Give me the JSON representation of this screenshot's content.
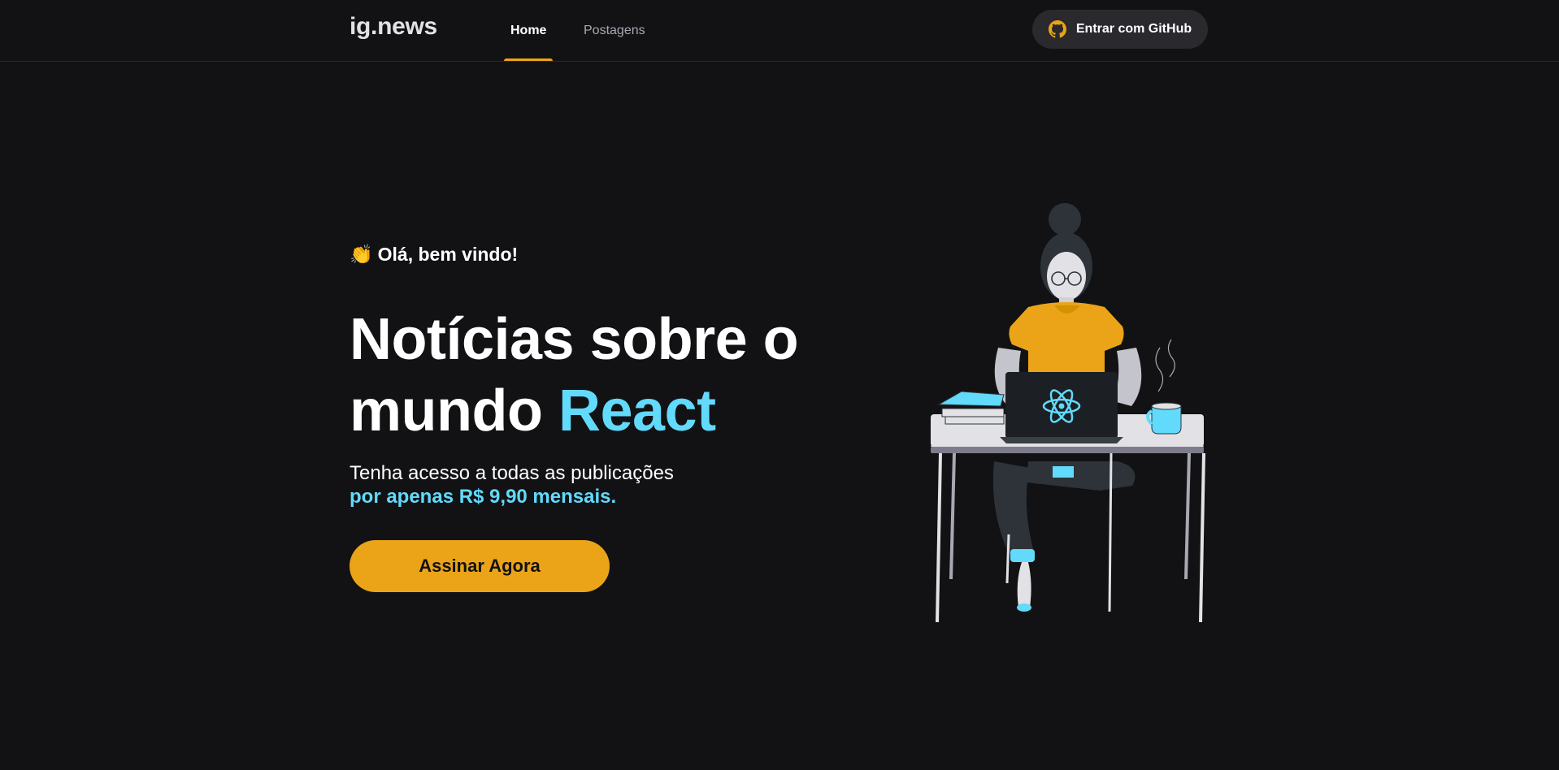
{
  "header": {
    "logo": "ig.news",
    "nav": [
      {
        "label": "Home",
        "active": true
      },
      {
        "label": "Postagens",
        "active": false
      }
    ],
    "github_button": "Entrar com GitHub"
  },
  "hero": {
    "welcome_emoji": "👏",
    "welcome": "Olá, bem vindo!",
    "headline_part1": "Notícias sobre o mundo",
    "headline_highlight": "React",
    "subtitle_line1": "Tenha acesso a todas as publicações",
    "subtitle_line2": "por apenas R$ 9,90 mensais.",
    "cta": "Assinar Agora"
  },
  "colors": {
    "background": "#121214",
    "accent_yellow": "#eba417",
    "accent_cyan": "#61dafb",
    "button_dark": "#29292e"
  }
}
